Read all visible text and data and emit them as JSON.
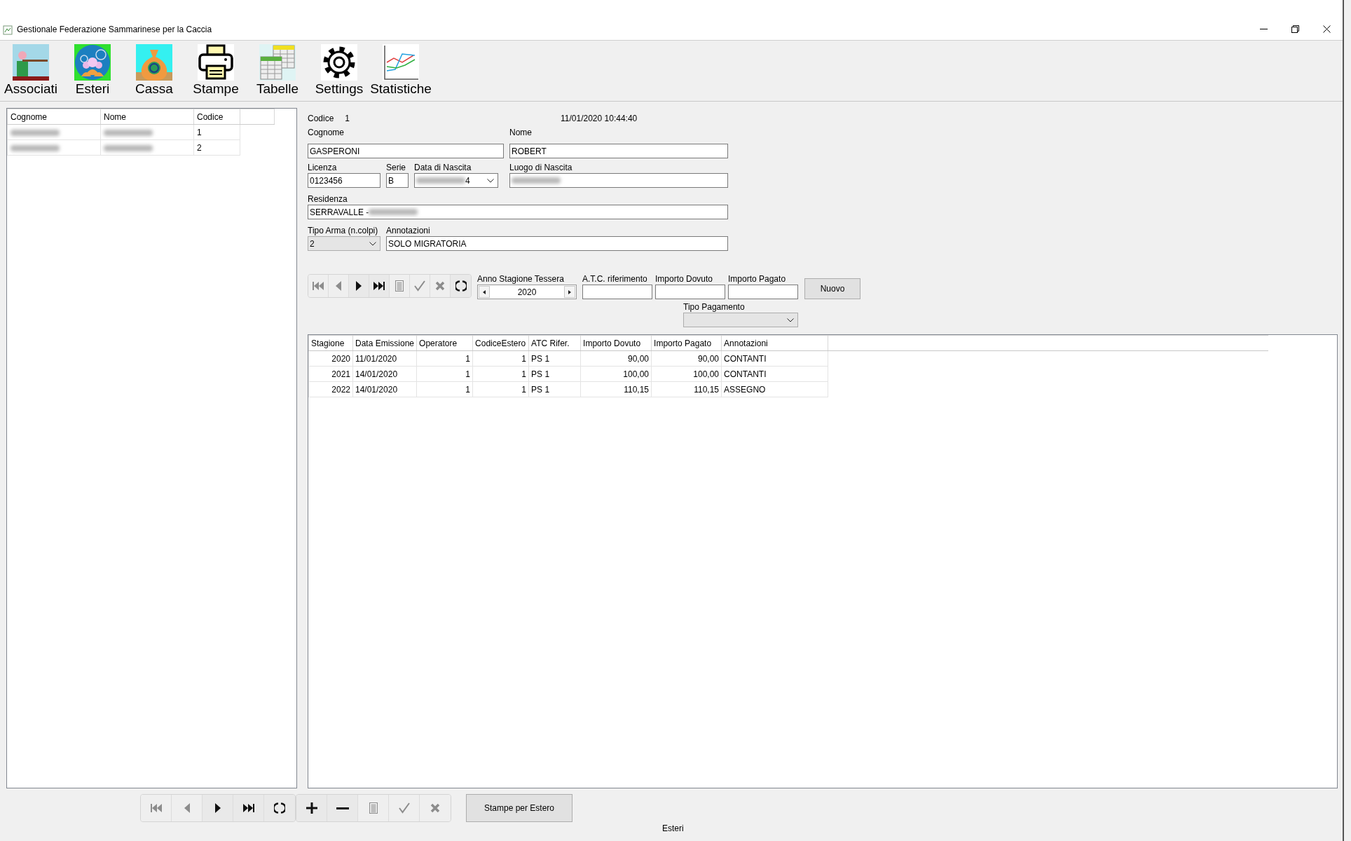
{
  "window": {
    "title": "Gestionale Federazione Sammarinese per la Caccia"
  },
  "toolbar": [
    {
      "label": "Associati",
      "kind": "shooter"
    },
    {
      "label": "Esteri",
      "kind": "people"
    },
    {
      "label": "Cassa",
      "kind": "money"
    },
    {
      "label": "Stampe",
      "kind": "printer"
    },
    {
      "label": "Tabelle",
      "kind": "tables"
    },
    {
      "label": "Settings",
      "kind": "gear"
    },
    {
      "label": "Statistiche",
      "kind": "chart"
    }
  ],
  "members_list": {
    "columns": [
      "Cognome",
      "Nome",
      "Codice"
    ],
    "rows": [
      {
        "cells": [
          {
            "blurred": true
          },
          {
            "blurred": true
          },
          {
            "text": "1"
          }
        ]
      },
      {
        "cells": [
          {
            "blurred": true
          },
          {
            "blurred": true
          },
          {
            "text": "2"
          }
        ]
      }
    ]
  },
  "detail": {
    "codice_label": "Codice",
    "codice": "1",
    "timestamp": "11/01/2020 10:44:40",
    "field_rows": [
      [
        {
          "label": "Cognome",
          "value": "GASPERONI",
          "kind": "text"
        },
        {
          "label": "Nome",
          "value": "ROBERT",
          "kind": "text"
        }
      ],
      [
        {
          "label": "Licenza",
          "value": "0123456",
          "kind": "text"
        },
        {
          "label": "Serie",
          "value": "B",
          "kind": "text"
        },
        {
          "label": "Data di Nascita",
          "value": "4",
          "kind": "date",
          "blurred_before": true
        },
        {
          "label": "Luogo di Nascita",
          "kind": "text",
          "blurred_before": true
        }
      ],
      [
        {
          "label": "Residenza",
          "value": "SERRAVALLE -",
          "kind": "text",
          "blurred_after": true
        }
      ],
      [
        {
          "label": "Tipo Arma (n.colpi)",
          "value": "2",
          "kind": "combo"
        },
        {
          "label": "Annotazioni",
          "value": "SOLO MIGRATORIA",
          "kind": "text"
        }
      ]
    ],
    "navigator": [
      {
        "kind": "first",
        "disabled": true
      },
      {
        "kind": "prev",
        "disabled": true
      },
      {
        "kind": "next",
        "disabled": false
      },
      {
        "kind": "last",
        "disabled": false
      },
      {
        "kind": "list",
        "disabled": true
      },
      {
        "kind": "check",
        "disabled": true
      },
      {
        "kind": "cancel",
        "disabled": true
      },
      {
        "kind": "refresh",
        "disabled": false
      }
    ],
    "season": {
      "label": "Anno Stagione Tessera",
      "value": "2020"
    },
    "payment_fields": [
      {
        "label": "A.T.C. riferimento"
      },
      {
        "label": "Importo Dovuto"
      },
      {
        "label": "Importo Pagato"
      }
    ],
    "new_button": "Nuovo",
    "payment_type": {
      "label": "Tipo Pagamento"
    },
    "grid": {
      "columns": [
        "Stagione",
        "Data Emissione",
        "Operatore",
        "CodiceEstero",
        "ATC Rifer.",
        "Importo Dovuto",
        "Importo Pagato",
        "Annotazioni"
      ],
      "rows": [
        [
          "2020",
          "11/01/2020",
          "1",
          "1",
          "PS 1",
          "90,00",
          "90,00",
          "CONTANTI"
        ],
        [
          "2021",
          "14/01/2020",
          "1",
          "1",
          "PS 1",
          "100,00",
          "100,00",
          "CONTANTI"
        ],
        [
          "2022",
          "14/01/2020",
          "1",
          "1",
          "PS 1",
          "110,15",
          "110,15",
          "ASSEGNO"
        ]
      ]
    }
  },
  "bottom_nav": [
    {
      "kind": "first",
      "disabled": true
    },
    {
      "kind": "prev",
      "disabled": true
    },
    {
      "kind": "next",
      "disabled": false
    },
    {
      "kind": "last",
      "disabled": false
    },
    {
      "kind": "refresh",
      "disabled": false
    },
    {
      "kind": "add",
      "disabled": false
    },
    {
      "kind": "remove",
      "disabled": false
    },
    {
      "kind": "list",
      "disabled": true
    },
    {
      "kind": "check",
      "disabled": true
    },
    {
      "kind": "cancel",
      "disabled": true
    }
  ],
  "print_button": "Stampe per Estero",
  "status_bar": "Esteri"
}
